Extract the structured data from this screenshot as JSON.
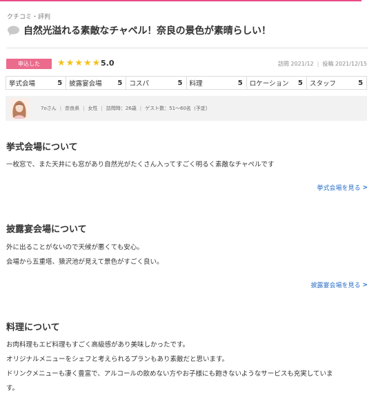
{
  "header": {
    "section_label": "クチコミ・評判",
    "review_title": "自然光溢れる素敵なチャペル！奈良の景色が素晴らしい！"
  },
  "summary": {
    "badge": "申込した",
    "rating": "5.0",
    "visit_date": "訪問 2021/12",
    "post_date": "投稿 2021/12/15"
  },
  "scores": [
    {
      "label": "挙式会場",
      "value": "5"
    },
    {
      "label": "披露宴会場",
      "value": "5"
    },
    {
      "label": "コスパ",
      "value": "5"
    },
    {
      "label": "料理",
      "value": "5"
    },
    {
      "label": "ロケーション",
      "value": "5"
    },
    {
      "label": "スタッフ",
      "value": "5"
    }
  ],
  "reviewer": {
    "name": "7oさん",
    "prefecture": "奈良県",
    "gender": "女性",
    "visit_age": "訪問時：26歳",
    "guests": "ゲスト数：51～60名（予定）"
  },
  "sections": [
    {
      "heading": "挙式会場について",
      "lines": [
        "一枚窓で、また天井にも窓があり自然光がたくさん入ってすごく明るく素敵なチャペルです"
      ],
      "link": "挙式会場を見る"
    },
    {
      "heading": "披露宴会場について",
      "lines": [
        "外に出ることがないので天候が悪くても安心。",
        "会場から五重塔、猿沢池が見えて景色がすごく良い。"
      ],
      "link": "披露宴会場を見る"
    },
    {
      "heading": "料理について",
      "lines": [
        "お肉料理もエビ料理もすごく高級感があり美味しかったです。",
        "オリジナルメニューをシェフと考えられるプランもあり素敵だと思います。",
        "ドリンクメニューも凄く豊富で、アルコールの飲めない方やお子様にも飽きないようなサービスも充実していま",
        "す。"
      ]
    }
  ],
  "colors": {
    "accent": "#ea4b86",
    "badge": "#eb6b8d",
    "star": "#f4c21b",
    "link": "#2a6fc9"
  },
  "icons": {
    "title_icon": "speech-bubble-icon",
    "star_icon": "star-icon",
    "link_icon": "chevron-right-icon"
  }
}
